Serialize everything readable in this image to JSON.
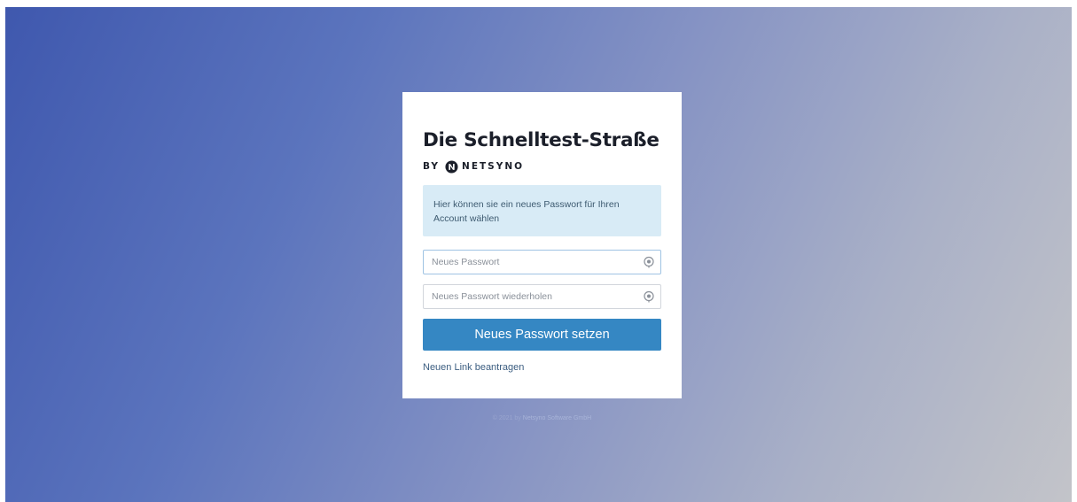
{
  "app": {
    "title": "Die Schnelltest-Straße",
    "brand_prefix": "BY",
    "brand_name": "NETSYNO"
  },
  "info": {
    "message": "Hier können sie ein neues Passwort für Ihren Account wählen"
  },
  "form": {
    "password_placeholder": "Neues Passwort",
    "password_value": "",
    "password_repeat_placeholder": "Neues Passwort wiederholen",
    "password_repeat_value": "",
    "submit_label": "Neues Passwort setzen",
    "request_link_label": "Neuen Link beantragen"
  },
  "footer": {
    "copyright": "© 2021 by",
    "org": "Netsyno Software GmbH"
  },
  "colors": {
    "primary_button": "#3587c3",
    "info_background": "#d8ebf6",
    "gradient_start": "#3f58ae",
    "gradient_end": "#c3c4c9"
  },
  "icons": {
    "brand_logo": "netsyno-logo-icon",
    "password_toggle": "eye-icon"
  }
}
